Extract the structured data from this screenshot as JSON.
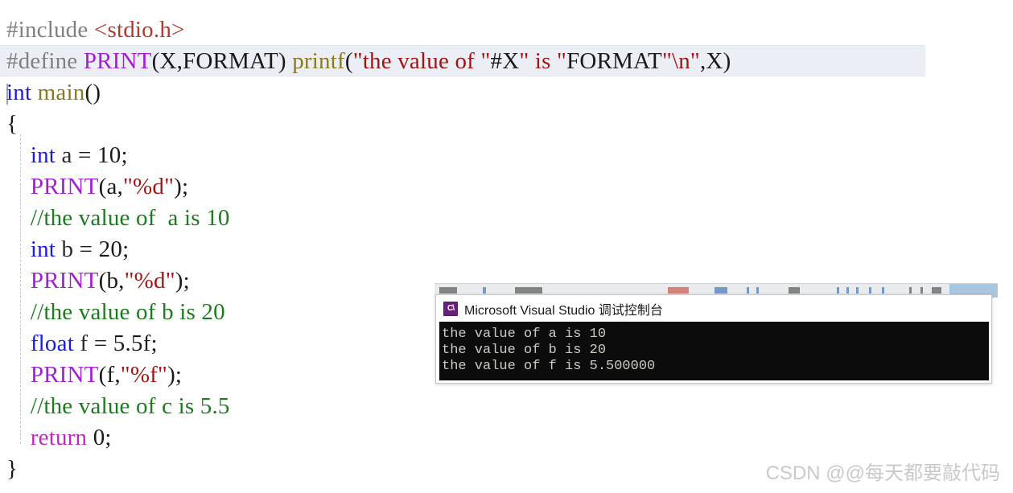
{
  "editor": {
    "language": "c",
    "current_line_index": 1,
    "lines": [
      {
        "id": "line-include",
        "text": "#include <stdio.h>",
        "tokens": [
          {
            "t": "#include ",
            "c": "t-pp"
          },
          {
            "t": "<stdio.h>",
            "c": "t-inc"
          }
        ]
      },
      {
        "id": "line-define",
        "text": "#define PRINT(X,FORMAT) printf(\"the value of \"#X\" is \"FORMAT\"\\n\",X)",
        "tokens": [
          {
            "t": "#define ",
            "c": "t-pp"
          },
          {
            "t": "PRINT",
            "c": "t-macro"
          },
          {
            "t": "(X,FORMAT) ",
            "c": "t-plain"
          },
          {
            "t": "printf",
            "c": "t-fn"
          },
          {
            "t": "(",
            "c": "t-plain"
          },
          {
            "t": "\"the value of \"",
            "c": "t-str"
          },
          {
            "t": "#X",
            "c": "t-plain"
          },
          {
            "t": "\" is \"",
            "c": "t-str"
          },
          {
            "t": "FORMAT",
            "c": "t-plain"
          },
          {
            "t": "\"\\n\"",
            "c": "t-str"
          },
          {
            "t": ",X)",
            "c": "t-plain"
          }
        ]
      },
      {
        "id": "line-main",
        "text": "int main()",
        "tokens": [
          {
            "t": "int ",
            "c": "t-kw"
          },
          {
            "t": "main",
            "c": "t-fn"
          },
          {
            "t": "()",
            "c": "t-plain"
          }
        ]
      },
      {
        "id": "line-open-brace",
        "text": "{",
        "tokens": [
          {
            "t": "{",
            "c": "t-plain"
          }
        ]
      },
      {
        "id": "line-int-a",
        "text": "    int a = 10;",
        "tokens": [
          {
            "t": "    ",
            "c": "t-plain"
          },
          {
            "t": "int",
            "c": "t-kw"
          },
          {
            "t": " a ",
            "c": "t-var"
          },
          {
            "t": "= ",
            "c": "t-plain"
          },
          {
            "t": "10",
            "c": "t-num"
          },
          {
            "t": ";",
            "c": "t-plain"
          }
        ]
      },
      {
        "id": "line-print-a",
        "text": "    PRINT(a,\"%d\");",
        "tokens": [
          {
            "t": "    ",
            "c": "t-plain"
          },
          {
            "t": "PRINT",
            "c": "t-macro"
          },
          {
            "t": "(a,",
            "c": "t-plain"
          },
          {
            "t": "\"%d\"",
            "c": "t-str"
          },
          {
            "t": ");",
            "c": "t-plain"
          }
        ]
      },
      {
        "id": "line-comment-a",
        "text": "    //the value of  a is 10",
        "tokens": [
          {
            "t": "    ",
            "c": "t-plain"
          },
          {
            "t": "//the value of  a is 10",
            "c": "t-cmt"
          }
        ]
      },
      {
        "id": "line-int-b",
        "text": "    int b = 20;",
        "tokens": [
          {
            "t": "    ",
            "c": "t-plain"
          },
          {
            "t": "int",
            "c": "t-kw"
          },
          {
            "t": " b ",
            "c": "t-var"
          },
          {
            "t": "= ",
            "c": "t-plain"
          },
          {
            "t": "20",
            "c": "t-num"
          },
          {
            "t": ";",
            "c": "t-plain"
          }
        ]
      },
      {
        "id": "line-print-b",
        "text": "    PRINT(b,\"%d\");",
        "tokens": [
          {
            "t": "    ",
            "c": "t-plain"
          },
          {
            "t": "PRINT",
            "c": "t-macro"
          },
          {
            "t": "(b,",
            "c": "t-plain"
          },
          {
            "t": "\"%d\"",
            "c": "t-str"
          },
          {
            "t": ");",
            "c": "t-plain"
          }
        ]
      },
      {
        "id": "line-comment-b",
        "text": "    //the value of b is 20",
        "tokens": [
          {
            "t": "    ",
            "c": "t-plain"
          },
          {
            "t": "//the value of b is 20",
            "c": "t-cmt"
          }
        ]
      },
      {
        "id": "line-float-f",
        "text": "    float f = 5.5f;",
        "tokens": [
          {
            "t": "    ",
            "c": "t-plain"
          },
          {
            "t": "float",
            "c": "t-kw"
          },
          {
            "t": " f ",
            "c": "t-var"
          },
          {
            "t": "= ",
            "c": "t-plain"
          },
          {
            "t": "5.5f",
            "c": "t-num"
          },
          {
            "t": ";",
            "c": "t-plain"
          }
        ]
      },
      {
        "id": "line-print-f",
        "text": "    PRINT(f,\"%f\");",
        "tokens": [
          {
            "t": "    ",
            "c": "t-plain"
          },
          {
            "t": "PRINT",
            "c": "t-macro"
          },
          {
            "t": "(f,",
            "c": "t-plain"
          },
          {
            "t": "\"%f\"",
            "c": "t-str"
          },
          {
            "t": ");",
            "c": "t-plain"
          }
        ]
      },
      {
        "id": "line-comment-c",
        "text": "    //the value of c is 5.5",
        "tokens": [
          {
            "t": "    ",
            "c": "t-plain"
          },
          {
            "t": "//the value of c is 5.5",
            "c": "t-cmt"
          }
        ]
      },
      {
        "id": "line-return",
        "text": "    return 0;",
        "tokens": [
          {
            "t": "    ",
            "c": "t-plain"
          },
          {
            "t": "return",
            "c": "t-kw2"
          },
          {
            "t": " ",
            "c": "t-plain"
          },
          {
            "t": "0",
            "c": "t-num"
          },
          {
            "t": ";",
            "c": "t-plain"
          }
        ]
      },
      {
        "id": "line-close-brace",
        "text": "}",
        "tokens": [
          {
            "t": "}",
            "c": "t-plain"
          }
        ]
      }
    ]
  },
  "console_window": {
    "icon": "vs-console-icon",
    "title": "Microsoft Visual Studio 调试控制台",
    "output_lines": [
      "the value of a is 10",
      "the value of b is 20",
      "the value of f is 5.500000"
    ]
  },
  "watermark": {
    "text": "CSDN @@每天都要敲代码"
  },
  "colors": {
    "preprocessor": "#808080",
    "include_path": "#b03a2e",
    "macro": "#a31fd4",
    "keyword": "#1a1ae8",
    "keyword_return": "#c026c0",
    "function": "#8a7a22",
    "string": "#a31515",
    "comment": "#1e7a1e",
    "current_line_highlight": "#eceef5",
    "console_background": "#0c0c0c",
    "console_text": "#ccc9c2",
    "console_icon": "#68217a",
    "watermark": "#c9c9c9"
  }
}
